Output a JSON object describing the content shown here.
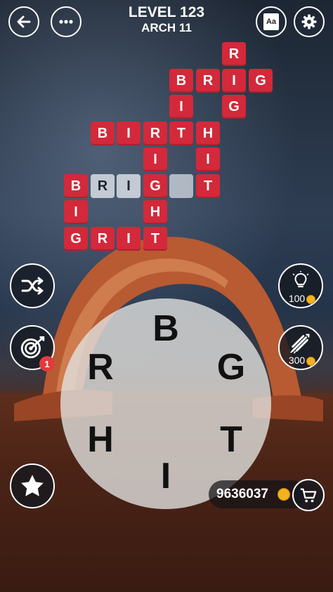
{
  "header": {
    "level_title": "LEVEL 123",
    "level_subtitle": "ARCH 11",
    "back_icon": "arrow-left-icon",
    "menu_icon": "more-dots-icon",
    "dictionary_icon": "dictionary-book-icon",
    "dictionary_text": "Aa",
    "settings_icon": "gear-icon"
  },
  "grid": {
    "tile_color": "#d3293a",
    "hint_color": "#c3cad4",
    "cells": [
      {
        "r": 0,
        "c": 6,
        "letter": "R",
        "state": "filled"
      },
      {
        "r": 1,
        "c": 4,
        "letter": "B",
        "state": "filled"
      },
      {
        "r": 1,
        "c": 5,
        "letter": "R",
        "state": "filled"
      },
      {
        "r": 1,
        "c": 6,
        "letter": "I",
        "state": "filled"
      },
      {
        "r": 1,
        "c": 7,
        "letter": "G",
        "state": "filled"
      },
      {
        "r": 2,
        "c": 4,
        "letter": "I",
        "state": "filled"
      },
      {
        "r": 2,
        "c": 6,
        "letter": "G",
        "state": "filled"
      },
      {
        "r": 3,
        "c": 1,
        "letter": "B",
        "state": "filled"
      },
      {
        "r": 3,
        "c": 2,
        "letter": "I",
        "state": "filled"
      },
      {
        "r": 3,
        "c": 3,
        "letter": "R",
        "state": "filled"
      },
      {
        "r": 3,
        "c": 4,
        "letter": "T",
        "state": "filled"
      },
      {
        "r": 3,
        "c": 5,
        "letter": "H",
        "state": "filled"
      },
      {
        "r": 4,
        "c": 3,
        "letter": "I",
        "state": "filled"
      },
      {
        "r": 4,
        "c": 5,
        "letter": "I",
        "state": "filled"
      },
      {
        "r": 5,
        "c": 0,
        "letter": "B",
        "state": "filled"
      },
      {
        "r": 5,
        "c": 1,
        "letter": "R",
        "state": "hint"
      },
      {
        "r": 5,
        "c": 2,
        "letter": "I",
        "state": "hint"
      },
      {
        "r": 5,
        "c": 3,
        "letter": "G",
        "state": "filled"
      },
      {
        "r": 5,
        "c": 4,
        "letter": "",
        "state": "empty"
      },
      {
        "r": 5,
        "c": 5,
        "letter": "T",
        "state": "filled"
      },
      {
        "r": 6,
        "c": 0,
        "letter": "I",
        "state": "filled"
      },
      {
        "r": 6,
        "c": 3,
        "letter": "H",
        "state": "filled"
      },
      {
        "r": 7,
        "c": 0,
        "letter": "G",
        "state": "filled"
      },
      {
        "r": 7,
        "c": 1,
        "letter": "R",
        "state": "filled"
      },
      {
        "r": 7,
        "c": 2,
        "letter": "I",
        "state": "filled"
      },
      {
        "r": 7,
        "c": 3,
        "letter": "T",
        "state": "filled"
      }
    ]
  },
  "side_buttons": {
    "shuffle_icon": "shuffle-icon",
    "target_icon": "target-dart-icon",
    "target_badge": "1",
    "star_icon": "star-icon",
    "hint_icon": "lightbulb-icon",
    "hint_cost": "100",
    "rocket_icon": "firework-rocket-icon",
    "rocket_cost": "300"
  },
  "wheel": {
    "letters": [
      "B",
      "G",
      "T",
      "I",
      "H",
      "R"
    ]
  },
  "coins": {
    "count": "9636037",
    "coin_icon": "coin-icon",
    "shop_icon": "shopping-cart-icon"
  }
}
